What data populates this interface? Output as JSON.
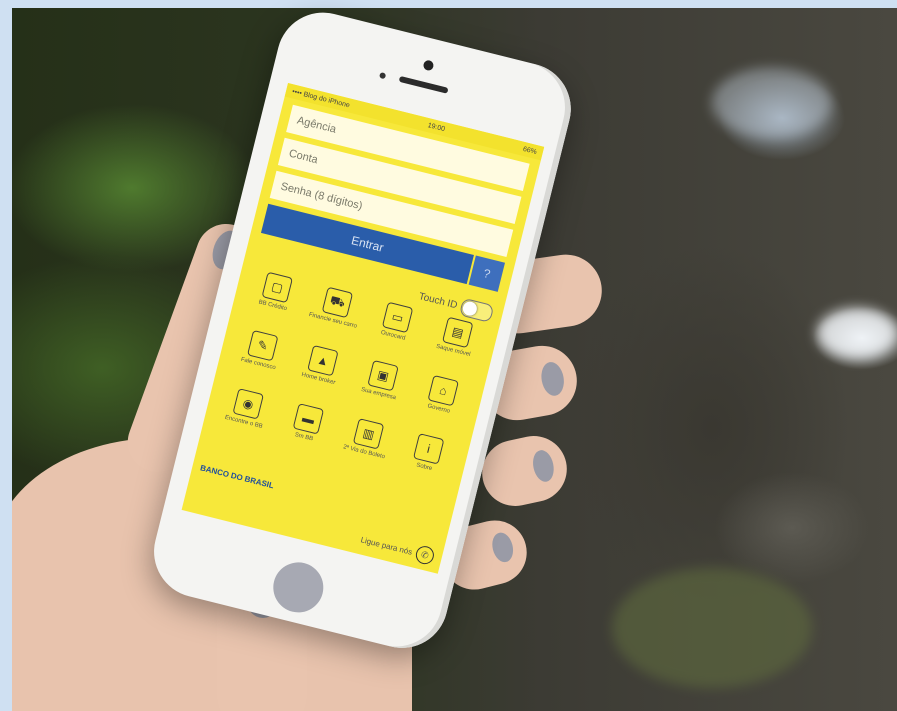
{
  "status_bar": {
    "carrier": "•••• Blog do iPhone",
    "time": "19:00",
    "battery": "66%"
  },
  "login": {
    "agencia_placeholder": "Agência",
    "conta_placeholder": "Conta",
    "senha_placeholder": "Senha (8 dígitos)",
    "enter_label": "Entrar",
    "help_label": "?"
  },
  "touch_id": {
    "label": "Touch ID",
    "enabled": false
  },
  "menu": [
    {
      "label": "BB Crédito",
      "icon": "bag-icon",
      "glyph": "▢"
    },
    {
      "label": "Financie seu carro",
      "icon": "car-icon",
      "glyph": "⛟"
    },
    {
      "label": "Ourocard",
      "icon": "card-icon",
      "glyph": "▭"
    },
    {
      "label": "Saque móvel",
      "icon": "atm-icon",
      "glyph": "▤"
    },
    {
      "label": "Fale conosco",
      "icon": "pencil-icon",
      "glyph": "✎"
    },
    {
      "label": "Home broker",
      "icon": "chart-icon",
      "glyph": "▲"
    },
    {
      "label": "Sua empresa",
      "icon": "briefcase-icon",
      "glyph": "▣"
    },
    {
      "label": "Governo",
      "icon": "building-icon",
      "glyph": "⌂"
    },
    {
      "label": "Encontre o BB",
      "icon": "location-icon",
      "glyph": "◉"
    },
    {
      "label": "Sm BB",
      "icon": "ticket-icon",
      "glyph": "▬"
    },
    {
      "label": "2ª Via do Boleto",
      "icon": "barcode-icon",
      "glyph": "▥"
    },
    {
      "label": "Sobre",
      "icon": "info-icon",
      "glyph": "i"
    }
  ],
  "footer": {
    "brand": "BANCO DO BRASIL",
    "call_label": "Ligue para nós"
  },
  "colors": {
    "app_yellow": "#f7e83a",
    "bb_blue": "#2a5daa",
    "frame_border": "#cfe0f2"
  }
}
